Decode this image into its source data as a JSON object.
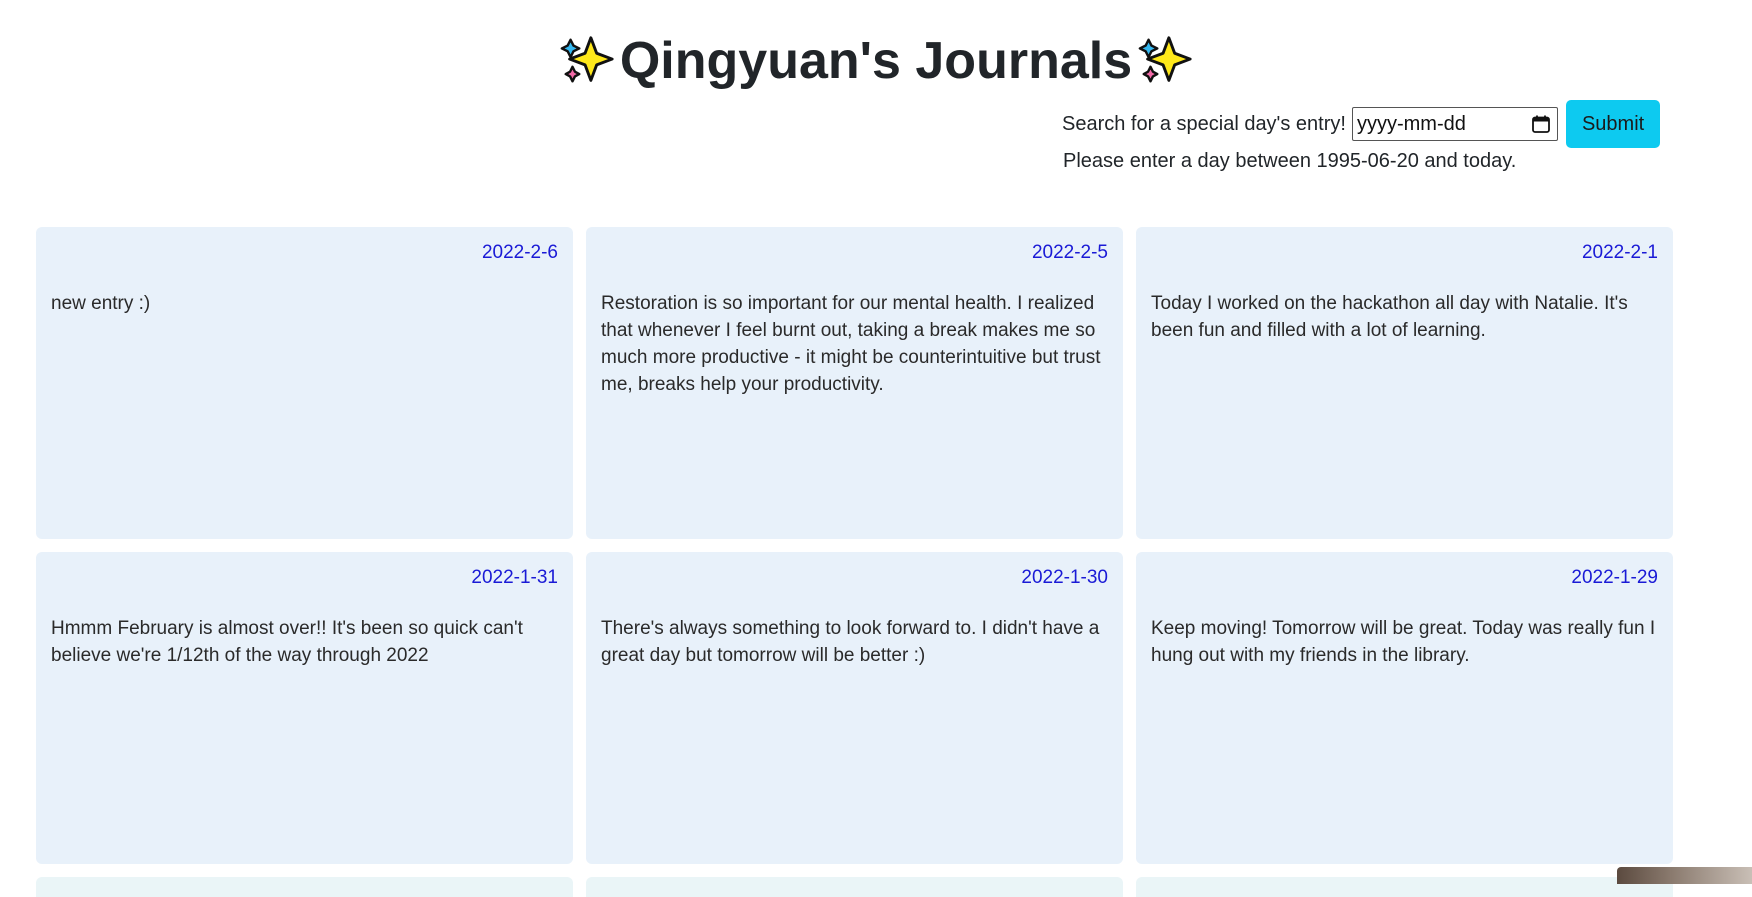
{
  "header": {
    "title": "Qingyuan's Journals",
    "left_icon": "sparkles-icon",
    "right_icon": "sparkles-icon"
  },
  "search": {
    "label": "Search for a special day's entry!",
    "placeholder": "yyyy-mm-dd",
    "submit_label": "Submit",
    "hint": "Please enter a day between 1995-06-20 and today."
  },
  "entries": [
    {
      "date": "2022-2-6",
      "text": "new entry :)"
    },
    {
      "date": "2022-2-5",
      "text": "Restoration is so important for our mental health. I realized that whenever I feel burnt out, taking a break makes me so much more productive - it might be counterintuitive but trust me, breaks help your productivity."
    },
    {
      "date": "2022-2-1",
      "text": "Today I worked on the hackathon all day with Natalie. It's been fun and filled with a lot of learning."
    },
    {
      "date": "2022-1-31",
      "text": "Hmmm February is almost over!! It's been so quick can't believe we're 1/12th of the way through 2022"
    },
    {
      "date": "2022-1-30",
      "text": "There's always something to look forward to. I didn't have a great day but tomorrow will be better :)"
    },
    {
      "date": "2022-1-29",
      "text": "Keep moving! Tomorrow will be great. Today was really fun I hung out with my friends in the library."
    }
  ],
  "colors": {
    "card_bg": "#e8f1fa",
    "date_link": "#1a1ad6",
    "submit_bg": "#0dcaf0"
  }
}
